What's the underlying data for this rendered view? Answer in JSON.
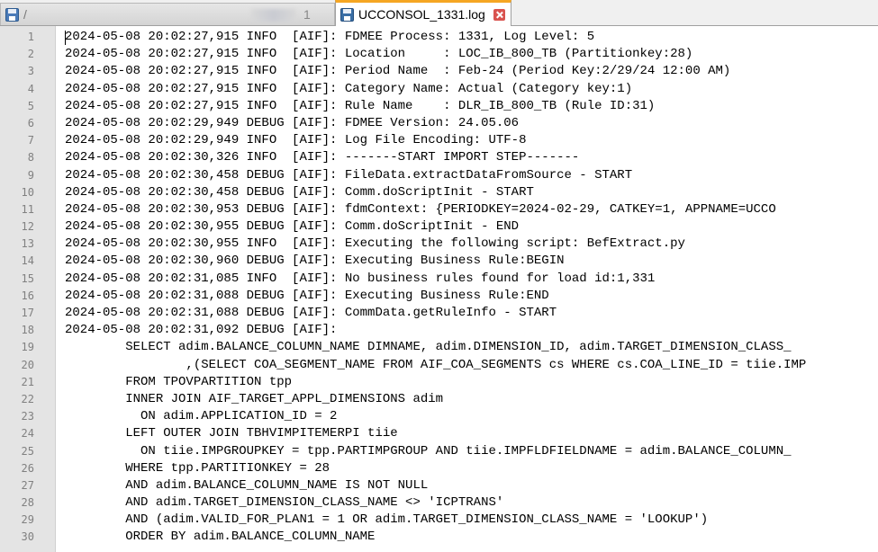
{
  "tabs": [
    {
      "title": "/",
      "suffix": "1",
      "active": false,
      "icon": "floppy-disk-icon",
      "icon_color": "#4a7ab8"
    },
    {
      "title": "UCCONSOL_1331.log",
      "active": true,
      "icon": "floppy-disk-icon",
      "icon_color": "#3a6ea5"
    }
  ],
  "editor": {
    "lines": [
      {
        "n": "1",
        "text": "2024-05-08 20:02:27,915 INFO  [AIF]: FDMEE Process: 1331, Log Level: 5"
      },
      {
        "n": "2",
        "text": "2024-05-08 20:02:27,915 INFO  [AIF]: Location     : LOC_IB_800_TB (Partitionkey:28)"
      },
      {
        "n": "3",
        "text": "2024-05-08 20:02:27,915 INFO  [AIF]: Period Name  : Feb-24 (Period Key:2/29/24 12:00 AM)"
      },
      {
        "n": "4",
        "text": "2024-05-08 20:02:27,915 INFO  [AIF]: Category Name: Actual (Category key:1)"
      },
      {
        "n": "5",
        "text": "2024-05-08 20:02:27,915 INFO  [AIF]: Rule Name    : DLR_IB_800_TB (Rule ID:31)"
      },
      {
        "n": "6",
        "text": "2024-05-08 20:02:29,949 DEBUG [AIF]: FDMEE Version: 24.05.06"
      },
      {
        "n": "7",
        "text": "2024-05-08 20:02:29,949 INFO  [AIF]: Log File Encoding: UTF-8"
      },
      {
        "n": "8",
        "text": "2024-05-08 20:02:30,326 INFO  [AIF]: -------START IMPORT STEP-------"
      },
      {
        "n": "9",
        "text": "2024-05-08 20:02:30,458 DEBUG [AIF]: FileData.extractDataFromSource - START"
      },
      {
        "n": "10",
        "text": "2024-05-08 20:02:30,458 DEBUG [AIF]: Comm.doScriptInit - START"
      },
      {
        "n": "11",
        "text": "2024-05-08 20:02:30,953 DEBUG [AIF]: fdmContext: {PERIODKEY=2024-02-29, CATKEY=1, APPNAME=UCCO"
      },
      {
        "n": "12",
        "text": "2024-05-08 20:02:30,955 DEBUG [AIF]: Comm.doScriptInit - END"
      },
      {
        "n": "13",
        "text": "2024-05-08 20:02:30,955 INFO  [AIF]: Executing the following script: BefExtract.py"
      },
      {
        "n": "14",
        "text": "2024-05-08 20:02:30,960 DEBUG [AIF]: Executing Business Rule:BEGIN"
      },
      {
        "n": "15",
        "text": "2024-05-08 20:02:31,085 INFO  [AIF]: No business rules found for load id:1,331"
      },
      {
        "n": "16",
        "text": "2024-05-08 20:02:31,088 DEBUG [AIF]: Executing Business Rule:END"
      },
      {
        "n": "17",
        "text": "2024-05-08 20:02:31,088 DEBUG [AIF]: CommData.getRuleInfo - START"
      },
      {
        "n": "18",
        "text": "2024-05-08 20:02:31,092 DEBUG [AIF]:"
      },
      {
        "n": "19",
        "text": "        SELECT adim.BALANCE_COLUMN_NAME DIMNAME, adim.DIMENSION_ID, adim.TARGET_DIMENSION_CLASS_"
      },
      {
        "n": "20",
        "text": "                ,(SELECT COA_SEGMENT_NAME FROM AIF_COA_SEGMENTS cs WHERE cs.COA_LINE_ID = tiie.IMP"
      },
      {
        "n": "21",
        "text": "        FROM TPOVPARTITION tpp"
      },
      {
        "n": "22",
        "text": "        INNER JOIN AIF_TARGET_APPL_DIMENSIONS adim"
      },
      {
        "n": "23",
        "text": "          ON adim.APPLICATION_ID = 2"
      },
      {
        "n": "24",
        "text": "        LEFT OUTER JOIN TBHVIMPITEMERPI tiie"
      },
      {
        "n": "25",
        "text": "          ON tiie.IMPGROUPKEY = tpp.PARTIMPGROUP AND tiie.IMPFLDFIELDNAME = adim.BALANCE_COLUMN_"
      },
      {
        "n": "26",
        "text": "        WHERE tpp.PARTITIONKEY = 28"
      },
      {
        "n": "27",
        "text": "        AND adim.BALANCE_COLUMN_NAME IS NOT NULL"
      },
      {
        "n": "28",
        "text": "        AND adim.TARGET_DIMENSION_CLASS_NAME <> 'ICPTRANS'"
      },
      {
        "n": "29",
        "text": "        AND (adim.VALID_FOR_PLAN1 = 1 OR adim.TARGET_DIMENSION_CLASS_NAME = 'LOOKUP')"
      },
      {
        "n": "30",
        "text": "        ORDER BY adim.BALANCE_COLUMN_NAME"
      }
    ]
  }
}
